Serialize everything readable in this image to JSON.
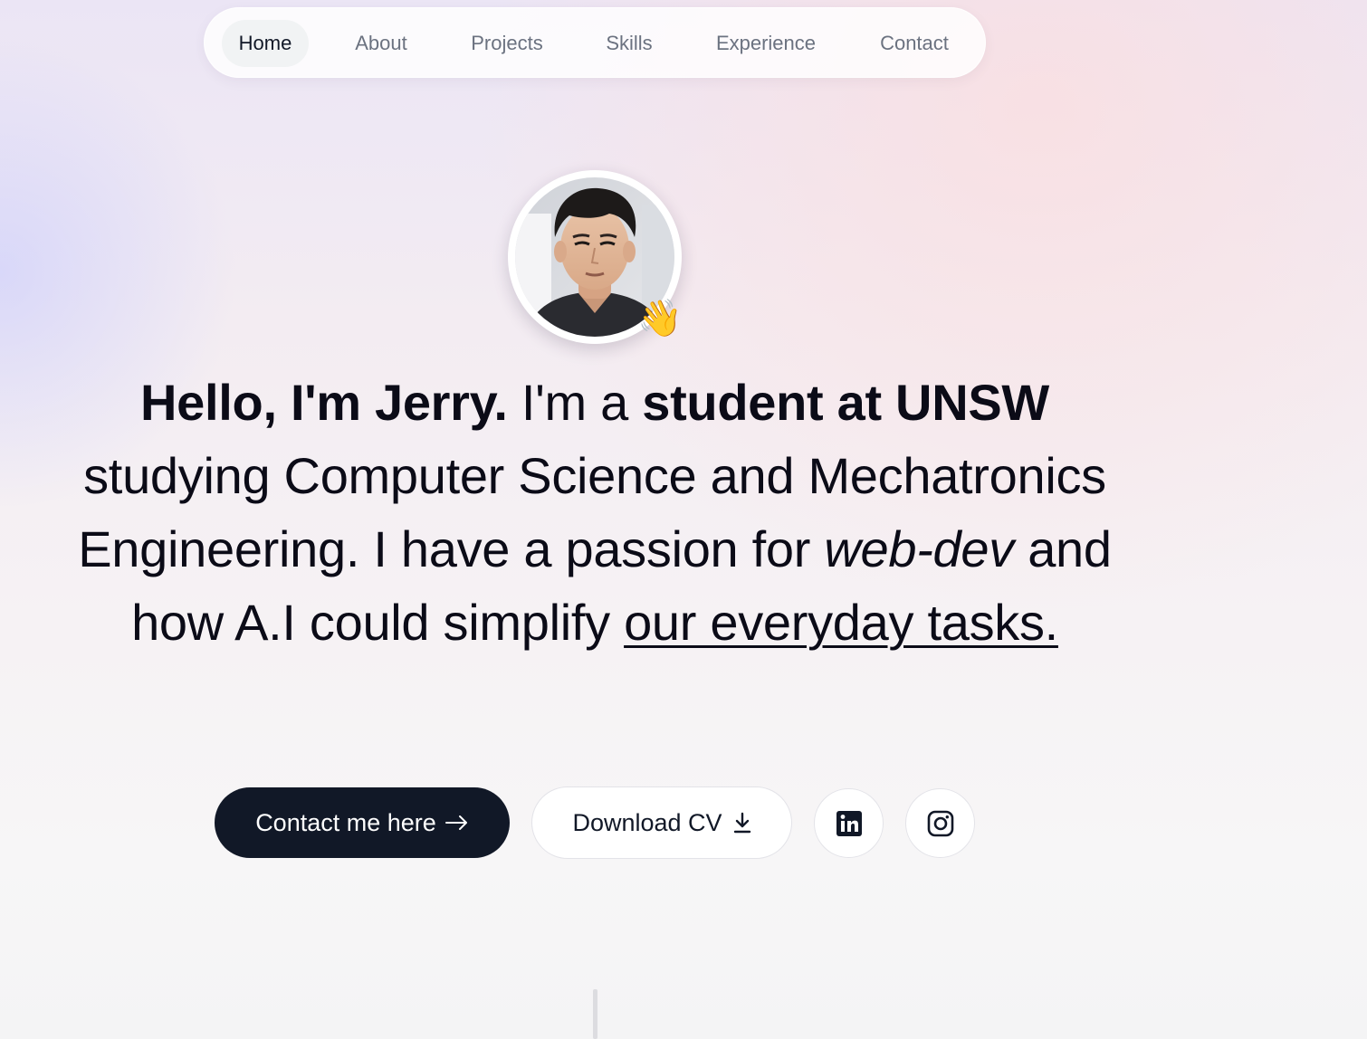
{
  "nav": {
    "items": [
      {
        "label": "Home",
        "active": true
      },
      {
        "label": "About"
      },
      {
        "label": "Projects"
      },
      {
        "label": "Skills"
      },
      {
        "label": "Experience"
      },
      {
        "label": "Contact"
      }
    ]
  },
  "profile": {
    "avatar_icon": "profile-photo",
    "wave_emoji": "👋"
  },
  "hero": {
    "greeting": "Hello, I'm Jerry.",
    "im_a": " I'm a ",
    "role": "student at UNSW",
    "studying": " studying Computer Science and Mechatronics Engineering. I have a passion for ",
    "interest": "web-dev",
    "and_how": " and how A.I could simplify ",
    "goal": "our everyday tasks."
  },
  "actions": {
    "contact_label": "Contact me here",
    "contact_icon": "arrow-right-icon",
    "cv_label": "Download CV",
    "cv_icon": "download-icon",
    "linkedin_icon": "linkedin-icon",
    "instagram_icon": "instagram-icon"
  },
  "colors": {
    "primary_button": "#111827",
    "text": "#0b0b17",
    "nav_muted": "#6b7280"
  }
}
